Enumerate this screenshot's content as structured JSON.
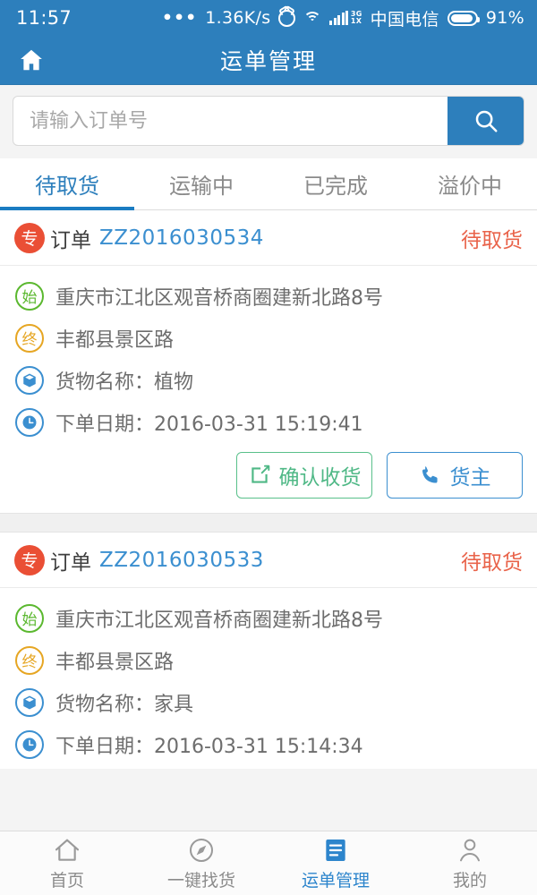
{
  "statusbar": {
    "time": "11:57",
    "dots": "•••",
    "net_speed": "1.36K/s",
    "network_type_top": "3G",
    "network_type_bottom": "1X",
    "carrier": "中国电信",
    "battery_pct": "91%",
    "battery_level": 91,
    "icons": [
      "alarm-icon",
      "wifi-icon",
      "signal-icon",
      "battery-icon"
    ]
  },
  "header": {
    "title": "运单管理",
    "home_icon": "home-icon",
    "bg_color": "#2d7fbc"
  },
  "search": {
    "placeholder": "请输入订单号",
    "value": "",
    "button_icon": "search-icon",
    "button_color": "#2d7fbc"
  },
  "tabs": {
    "active_index": 0,
    "items": [
      {
        "label": "待取货"
      },
      {
        "label": "运输中"
      },
      {
        "label": "已完成"
      },
      {
        "label": "溢价中"
      }
    ],
    "active_color": "#2d7fbc",
    "inactive_color": "#8a8a8a"
  },
  "orders": [
    {
      "badge": "专",
      "order_label": "订单",
      "order_no": "ZZ2016030534",
      "status": "待取货",
      "status_color": "#e9634a",
      "start_mark": "始",
      "start_address": "重庆市江北区观音桥商圈建新北路8号",
      "end_mark": "终",
      "end_address": "丰都县景区路",
      "cargo_text": "货物名称：植物",
      "date_text": "下单日期：2016-03-31 15:19:41",
      "buttons": [
        {
          "label": "确认收货",
          "icon": "edit-icon",
          "color": "#4fb886"
        },
        {
          "label": "货主",
          "icon": "phone-icon",
          "color": "#3b8fd0"
        }
      ]
    },
    {
      "badge": "专",
      "order_label": "订单",
      "order_no": "ZZ2016030533",
      "status": "待取货",
      "status_color": "#e9634a",
      "start_mark": "始",
      "start_address": "重庆市江北区观音桥商圈建新北路8号",
      "end_mark": "终",
      "end_address": "丰都县景区路",
      "cargo_text": "货物名称：家具",
      "date_text": "下单日期：2016-03-31 15:14:34"
    }
  ],
  "bottomnav": {
    "active_index": 2,
    "items": [
      {
        "label": "首页",
        "icon": "home-icon"
      },
      {
        "label": "一键找货",
        "icon": "compass-icon"
      },
      {
        "label": "运单管理",
        "icon": "document-icon"
      },
      {
        "label": "我的",
        "icon": "person-icon"
      }
    ],
    "active_color": "#2d85cc"
  }
}
